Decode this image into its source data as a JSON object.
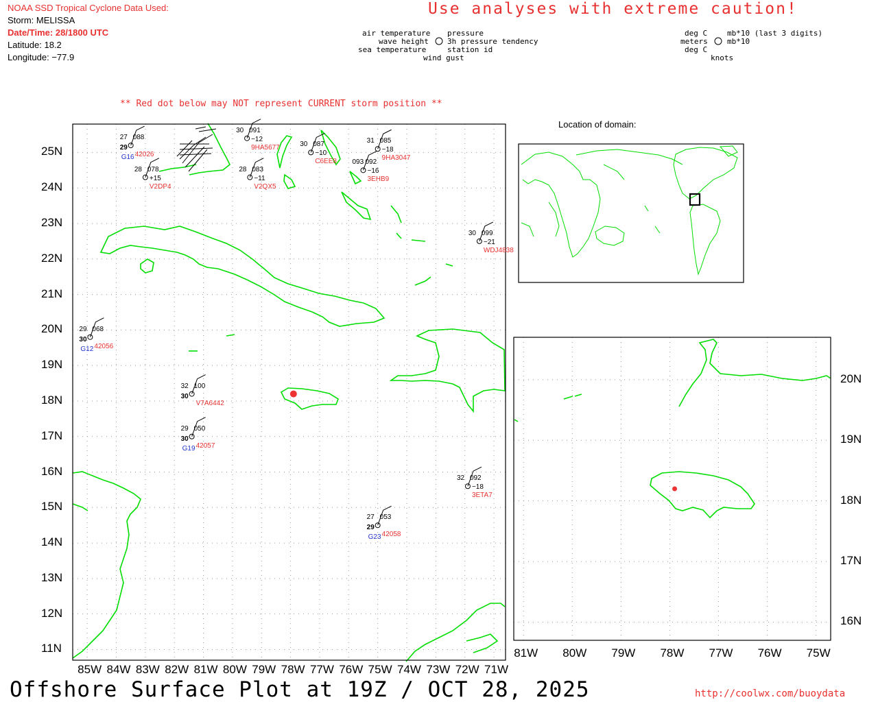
{
  "header": {
    "source_line": "NOAA SSD Tropical Cyclone Data Used:",
    "storm": "Storm: MELISSA",
    "datetime": "Date/Time: 28/1800 UTC",
    "latitude": "Latitude: 18.2",
    "longitude": "Longitude: −77.9",
    "caution": "Use analyses with extreme caution!",
    "red_dot_note": "** Red dot below may NOT represent CURRENT storm position **",
    "location_label": "Location of domain:"
  },
  "legend_left": {
    "air_temperature": "air temperature",
    "wave_height": "wave height",
    "sea_temperature": "sea temperature",
    "pressure": "pressure",
    "tendency": "3h pressure tendency",
    "station_id": "station id",
    "wind_gust": "wind gust"
  },
  "legend_right": {
    "deg_c_1": "deg C",
    "meters": "meters",
    "deg_c_2": "deg C",
    "mb_digits": "mb*10 (last 3 digits)",
    "mb": "mb*10",
    "knots": "knots"
  },
  "main_map": {
    "lat_ticks": [
      "25N",
      "24N",
      "23N",
      "22N",
      "21N",
      "20N",
      "19N",
      "18N",
      "17N",
      "16N",
      "15N",
      "14N",
      "13N",
      "12N",
      "11N"
    ],
    "lon_ticks": [
      "85W",
      "84W",
      "83W",
      "82W",
      "81W",
      "80W",
      "79W",
      "78W",
      "77W",
      "76W",
      "75W",
      "74W",
      "73W",
      "72W",
      "71W"
    ],
    "storm_position": {
      "lat": 18.2,
      "lon": -77.9
    },
    "stations": [
      {
        "id": "42056",
        "air": "29",
        "pres": "068",
        "sea": "30",
        "id2": "G12"
      },
      {
        "id": "V7A6442",
        "air": "32",
        "pres": "100",
        "sea": "30"
      },
      {
        "id": "42057",
        "air": "29",
        "pres": "050",
        "sea": "30",
        "id2": "G19"
      },
      {
        "id": "42058",
        "air": "27",
        "pres": "053",
        "sea": "29",
        "id2": "G23"
      },
      {
        "id": "3ETA7",
        "air": "32",
        "pres": "092",
        "tend": "−18"
      },
      {
        "id": "WDJ4838",
        "air": "30",
        "pres": "099",
        "tend": "−21"
      },
      {
        "id": "42026",
        "air": "27",
        "pres": "088",
        "sea": "29",
        "id2": "G16"
      },
      {
        "id": "V2DP4",
        "air": "28",
        "pres": "078",
        "tend": "+15"
      },
      {
        "id": "V2QX5",
        "air": "28",
        "pres": "083",
        "tend": "−11"
      },
      {
        "id": "9HA5677",
        "air": "30",
        "pres": "091",
        "tend": "−12"
      },
      {
        "id": "9HA3047",
        "air": "31",
        "pres": "085",
        "tend": "−18"
      },
      {
        "id": "3EHB9",
        "air": "093",
        "pres": "092",
        "tend": "−16"
      },
      {
        "id": "C6EE8",
        "air": "30",
        "pres": "087",
        "tend": "−10"
      }
    ]
  },
  "inset_map": {
    "lat_ticks": [
      "20N",
      "19N",
      "18N",
      "17N",
      "16N"
    ],
    "lon_ticks": [
      "81W",
      "80W",
      "79W",
      "78W",
      "77W",
      "76W",
      "75W"
    ]
  },
  "footer": {
    "title": "Offshore Surface Plot at 19Z / OCT 28, 2025",
    "url": "http://coolwx.com/buoydata"
  },
  "colors": {
    "coast": "#00dd00",
    "storm": "#ee3333",
    "station_id": "#e83030",
    "secondary_id": "#2233cc"
  }
}
